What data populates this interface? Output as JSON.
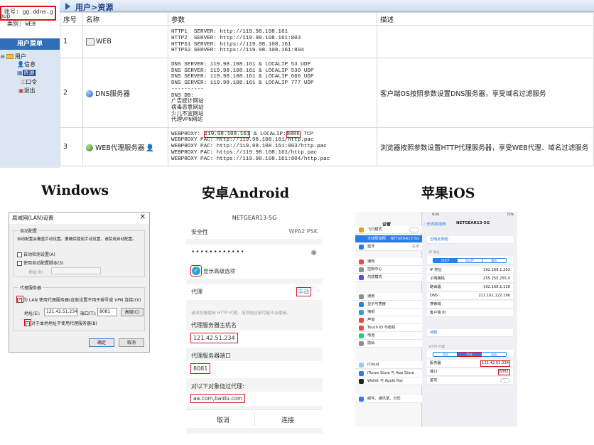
{
  "admin": {
    "account_label": "账号: gg.ddns.g",
    "account_suffix": "oup",
    "type_label": "类别: WEB",
    "side_header": "用户菜单",
    "tree_root": "用户",
    "tree_items": [
      "信息",
      "资源",
      "口令",
      "退出"
    ],
    "breadcrumb": "用户>资源",
    "columns": [
      "序号",
      "名称",
      "参数",
      "描述"
    ],
    "rows": [
      {
        "no": "1",
        "name": "WEB",
        "params": "HTTP1  SERVER: http://119.98.108.161\nHTTP2  SERVER: http://119.98.108.161:803\nHTTPS1 SERVER: https://119.98.108.161\nHTTPS2 SERVER: https://119.98.108.161:804",
        "desc": ""
      },
      {
        "no": "2",
        "name": "DNS服务器",
        "params": "DNS SERVER: 119.98.108.161 & LOCALIP 53 UDP\nDNS SERVER: 119.98.108.161 & LOCALIP 530 UDP\nDNS SERVER: 119.98.108.161 & LOCALIP 666 UDP\nDNS SERVER: 119.98.108.161 & LOCALIP 777 UDP\n----------\nDNS DB:\n广告统计网站\n病毒恶意网站\n少儿不宜网站\n代理VPN网站",
        "desc": "客户端OS按照参数设置DNS服务器，享受域名过滤服务"
      },
      {
        "no": "3",
        "name": "WEB代理服务器",
        "proxy_prefix": "WEBPROXY: ",
        "proxy_ip": "119.98.108.161",
        "proxy_mid": " & LOCALIP:",
        "proxy_port": "8086",
        "proxy_suffix": " TCP",
        "params_rest": "WEBPROXY PAC: http://119.98.108.161/http.pac\nWEBPROXY PAC: http://119.98.108.161:803/http.pac\nWEBPROXY PAC: https://119.98.108.161/http.pac\nWEBPROXY PAC: https://119.98.108.161:804/http.pac",
        "desc": "浏览器按照参数设置HTTP代理服务器，享受WEB代理、域名过滤服务"
      }
    ]
  },
  "sections": {
    "windows": "Windows",
    "android": "安卓Android",
    "ios": "苹果iOS"
  },
  "windows": {
    "title": "局域网(LAN)设置",
    "auto_group": "自动配置",
    "auto_desc": "自动配置会覆盖手动设置。要确保使用手动设置，请禁用自动配置。",
    "auto_detect": "自动检测设置(A)",
    "auto_script": "使用自动配置脚本(S)",
    "address_label": "地址(R)",
    "proxy_group": "代理服务器",
    "use_proxy": "为 LAN 使用代理服务器(这些设置不用于拨号或 VPN 连接)(X)",
    "addr_label": "地址(E):",
    "addr_value": "121.42.51.234",
    "port_label": "端口(T):",
    "port_value": "8081",
    "advanced": "高级(C)",
    "bypass": "对于本地地址不使用代理服务器(B)",
    "ok": "确定",
    "cancel": "取消"
  },
  "android": {
    "ssid": "NETGEAR13-5G",
    "security_label": "安全性",
    "security_value": "WPA2 PSK",
    "password": "••••••••••••",
    "advanced": "显示高级选项",
    "proxy_label": "代理",
    "proxy_value": "手动",
    "hint": "该浏览器使用 HTTP 代理，但其他应用可能不会使用。",
    "host_label": "代理服务器主机名",
    "host_value": "121.42.51.234",
    "port_label": "代理服务器端口",
    "port_value": "8081",
    "bypass_label": "对以下对象绕过代理:",
    "bypass_value": "aa.com,baidu.com",
    "cancel": "取消",
    "connect": "连接"
  },
  "ios": {
    "status_left": "iPad",
    "status_time": "9:28",
    "status_right": "72%",
    "settings_title": "设置",
    "back_label": "无线局域网",
    "network_title": "NETGEAR13-5G",
    "forget": "忽略此网络",
    "ip_header": "IP 地址",
    "segments": [
      "DHCP",
      "BootP",
      "静态"
    ],
    "ip_rows": [
      {
        "k": "IP 地址",
        "v": "192.168.1.202"
      },
      {
        "k": "子网掩码",
        "v": "255.255.255.0"
      },
      {
        "k": "路由器",
        "v": "192.168.1.118"
      },
      {
        "k": "DNS",
        "v": "211.161.122.196"
      },
      {
        "k": "搜索域",
        "v": ""
      },
      {
        "k": "客户端 ID",
        "v": ""
      }
    ],
    "renew": "续租",
    "http_header": "HTTP 代理",
    "proxy_segments": [
      "关闭",
      "手动",
      "自动"
    ],
    "server_label": "服务器",
    "server_value": "121.42.51.234",
    "port_label": "端口",
    "port_value": "8081",
    "auth_label": "鉴定",
    "menu": [
      {
        "label": "飞行模式",
        "value": "",
        "color": "#f39c12"
      },
      {
        "label": "无线局域网",
        "value": "NETGEAR13-5G",
        "color": "#2d7be5"
      },
      {
        "label": "蓝牙",
        "value": "关闭",
        "color": "#2d7be5"
      },
      {
        "label": "通知",
        "value": "",
        "color": "#e74c3c"
      },
      {
        "label": "控制中心",
        "value": "",
        "color": "#8e8e93"
      },
      {
        "label": "勿扰模式",
        "value": "",
        "color": "#5b4bd6"
      },
      {
        "label": "通用",
        "value": "",
        "color": "#8e8e93"
      },
      {
        "label": "显示与亮度",
        "value": "",
        "color": "#2d7be5"
      },
      {
        "label": "墙纸",
        "value": "",
        "color": "#2aa4d5"
      },
      {
        "label": "声音",
        "value": "",
        "color": "#e74c3c"
      },
      {
        "label": "Touch ID 与密码",
        "value": "",
        "color": "#e74c3c"
      },
      {
        "label": "电池",
        "value": "",
        "color": "#2ecc71"
      },
      {
        "label": "隐私",
        "value": "",
        "color": "#8e8e93"
      },
      {
        "label": "iCloud",
        "value": "",
        "color": "#9ec9f0"
      },
      {
        "label": "iTunes Store 与 App Store",
        "value": "",
        "color": "#2d7be5"
      },
      {
        "label": "Wallet 与 Apple Pay",
        "value": "",
        "color": "#222"
      },
      {
        "label": "邮件、通讯录、日历",
        "value": "",
        "color": "#2d7be5"
      }
    ]
  }
}
